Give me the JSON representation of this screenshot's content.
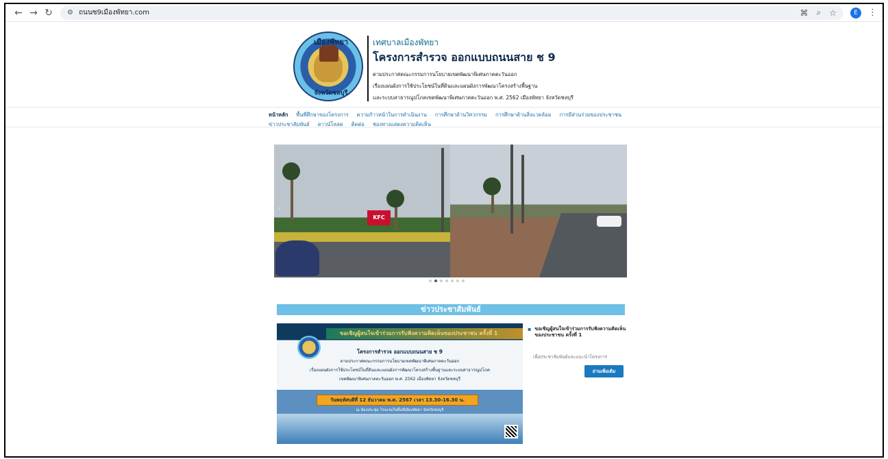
{
  "browser": {
    "url": "ถนนซ9เมืองพัทยา.com",
    "profile_initial": "E",
    "icons": [
      "back-icon",
      "forward-icon",
      "reload-icon",
      "site-info-icon",
      "translate-icon",
      "zoom-icon",
      "bookmark-star-icon",
      "kebab-menu-icon"
    ]
  },
  "header": {
    "logo_text_top": "เมืองพัทยา",
    "logo_text_bottom": "จังหวัดชลบุรี",
    "org": "เทศบาลเมืองพัทยา",
    "project_title": "โครงการสำรวจ ออกแบบถนนสาย ช 9",
    "lines": [
      "ตามประกาศคณะกรรมการนโยบายเขตพัฒนาพิเศษภาคตะวันออก",
      "เรื่องแผนผังการใช้ประโยชน์ในที่ดินและแผนผังการพัฒนาโครงสร้างพื้นฐาน",
      "และระบบสาธารณูปโภคเขตพัฒนาพิเศษภาคตะวันออก พ.ศ. 2562 เมืองพัทยา จังหวัดชลบุรี"
    ]
  },
  "menu": {
    "row1": [
      {
        "label": "หน้าหลัก",
        "active": true
      },
      {
        "label": "พื้นที่ศึกษาของโครงการ",
        "active": false
      },
      {
        "label": "ความก้าวหน้าในการดำเนินงาน",
        "active": false
      },
      {
        "label": "การศึกษาด้านวิศวกรรม",
        "active": false
      },
      {
        "label": "การศึกษาด้านสิ่งแวดล้อม",
        "active": false
      },
      {
        "label": "การมีส่วนร่วมของประชาชน",
        "active": false
      }
    ],
    "row2": [
      {
        "label": "ข่าวประชาสัมพันธ์",
        "active": false
      },
      {
        "label": "ดาวน์โหลด",
        "active": false
      },
      {
        "label": "ติดต่อ",
        "active": false
      },
      {
        "label": "ช่องทางแสดงความคิดเห็น",
        "active": false
      }
    ]
  },
  "slider": {
    "kfc_sign": "KFC",
    "dot_count": 7,
    "active_dot": 1
  },
  "news": {
    "section_title": "ข่าวประชาสัมพันธ์",
    "poster": {
      "banner": "ขอเชิญผู้สนใจเข้าร่วมการรับฟังความคิดเห็นของประชาชน ครั้งที่ 1",
      "lines": [
        "โครงการสำรวจ ออกแบบถนนสาย ช 9",
        "ตามประกาศคณะกรรมการนโยบายเขตพัฒนาพิเศษภาคตะวันออก",
        "เรื่องแผนผังการใช้ประโยชน์ในที่ดินและแผนผังการพัฒนาโครงสร้างพื้นฐานและระบบสาธารณูปโภค",
        "เขตพัฒนาพิเศษภาคตะวันออก พ.ศ. 2562 เมืองพัทยา จังหวัดชลบุรี"
      ],
      "date": "วันพฤหัสบดีที่ 12 ธันวาคม พ.ศ. 2567 เวลา 13.30-16.30 น.",
      "venue": "ณ ห้องประชุม โรงแรมในพื้นที่เมืองพัทยา จังหวัดชลบุรี"
    },
    "item_title": "ขอเชิญผู้สนใจเข้าร่วมการรับฟังความคิดเห็นของประชาชน ครั้งที่ 1",
    "item_desc": "เพื่อประชาสัมพันธ์และแนะนำโครงการ",
    "read_more": "อ่านเพิ่มเติม"
  }
}
